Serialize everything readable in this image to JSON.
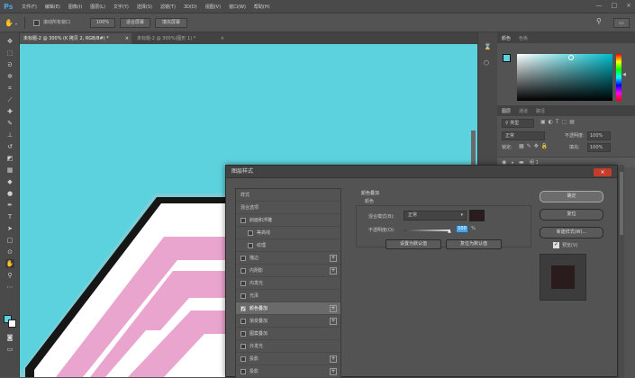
{
  "app": {
    "logo": "Ps"
  },
  "menu": [
    "文件(F)",
    "编辑(E)",
    "图像(I)",
    "图层(L)",
    "文字(Y)",
    "选择(S)",
    "滤镜(T)",
    "3D(D)",
    "视图(V)",
    "窗口(W)",
    "帮助(H)"
  ],
  "window_controls": {
    "minimize": "—",
    "restore": "□",
    "close": "×"
  },
  "options": {
    "scroll_all": "滚动所有窗口",
    "zoom": "100%",
    "fit_screen": "适合屏幕",
    "fill_screen": "填充屏幕"
  },
  "tabs": [
    {
      "label": "未标题-2 @ 300% (K 拷贝 2, RGB/8#) *",
      "close": "×"
    },
    {
      "label": "未标题-2 @ 300%(图形 1) *",
      "close": "×"
    }
  ],
  "colors": {
    "canvas": "#5cd2de",
    "shape_pink": "#eaa5cf",
    "shape_black": "#161616",
    "dialog_close": "#c43c2c",
    "overlay_color": "#2a1c1c",
    "preview": "#2a1c1c"
  },
  "right_panel": {
    "color_tab": "颜色",
    "swatches_tab": "色板",
    "layers_tab": "图层",
    "channels_tab": "通道",
    "paths_tab": "路径",
    "kind_filter": "类型",
    "blend_mode": "正常",
    "opacity_label": "不透明度:",
    "opacity_value": "100%",
    "lock_label": "锁定:",
    "fill_label": "填充:",
    "fill_value": "100%",
    "group_name": "组 1"
  },
  "dialog": {
    "title": "图层样式",
    "close": "×",
    "styles_header": "样式",
    "blend_options": "混合选项",
    "styles": [
      {
        "label": "斜面和浮雕",
        "checked": false,
        "plus": false
      },
      {
        "label": "等高线",
        "checked": false,
        "plus": false,
        "indent": true
      },
      {
        "label": "纹理",
        "checked": false,
        "plus": false,
        "indent": true
      },
      {
        "label": "描边",
        "checked": false,
        "plus": true
      },
      {
        "label": "内阴影",
        "checked": false,
        "plus": true
      },
      {
        "label": "内发光",
        "checked": false,
        "plus": false
      },
      {
        "label": "光泽",
        "checked": false,
        "plus": false
      },
      {
        "label": "颜色叠加",
        "checked": true,
        "plus": true,
        "active": true
      },
      {
        "label": "渐变叠加",
        "checked": false,
        "plus": true
      },
      {
        "label": "图案叠加",
        "checked": false,
        "plus": false
      },
      {
        "label": "外发光",
        "checked": false,
        "plus": false
      },
      {
        "label": "投影",
        "checked": false,
        "plus": true
      },
      {
        "label": "投影",
        "checked": false,
        "plus": true
      }
    ],
    "section_title": "颜色叠加",
    "section_sub": "颜色",
    "blend_label": "混合模式(B):",
    "blend_value": "正常",
    "opacity_label": "不透明度(O):",
    "opacity_value": "100",
    "opacity_unit": "%",
    "set_default": "设置为默认值",
    "reset_default": "复位为默认值",
    "ok": "确定",
    "reset": "复位",
    "new_style": "新建样式(W)...",
    "preview_label": "预览(V)"
  }
}
